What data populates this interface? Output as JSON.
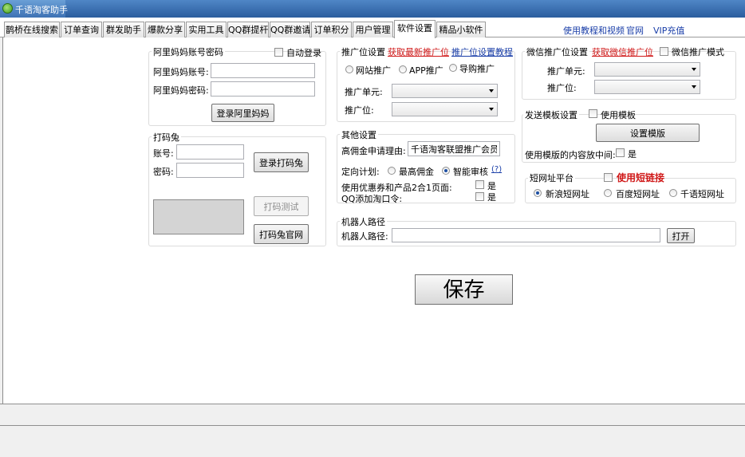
{
  "window": {
    "title": "千语淘客助手"
  },
  "tabs": [
    {
      "label": "鹊桥在线搜索"
    },
    {
      "label": "订单查询"
    },
    {
      "label": "群发助手"
    },
    {
      "label": "爆款分享"
    },
    {
      "label": "实用工具"
    },
    {
      "label": "QQ群提杆"
    },
    {
      "label": "QQ群邀请"
    },
    {
      "label": "订单积分"
    },
    {
      "label": "用户管理"
    },
    {
      "label": "软件设置"
    },
    {
      "label": "精品小软件"
    }
  ],
  "top_links": {
    "tutorial": "使用教程和视频",
    "official": "官网",
    "vip": "VIP充值"
  },
  "alimama": {
    "title": "阿里妈妈账号密码",
    "auto_login": "自动登录",
    "account_label": "阿里妈妈账号:",
    "account_value": "",
    "password_label": "阿里妈妈密码:",
    "password_value": "",
    "login_button": "登录阿里妈妈"
  },
  "captcha": {
    "title": "打码兔",
    "account_label": "账号:",
    "account_value": "",
    "password_label": "密码:",
    "password_value": "",
    "login_button": "登录打码兔",
    "test_button": "打码测试",
    "site_button": "打码兔官网"
  },
  "promo": {
    "title": "推广位设置",
    "get_latest_link": "获取最新推广位",
    "tutorial_link": "推广位设置教程",
    "radio_site": "网站推广",
    "radio_app": "APP推广",
    "radio_guide": "导购推广",
    "unit_label": "推广单元:",
    "position_label": "推广位:"
  },
  "other": {
    "title": "其他设置",
    "reason_label": "高佣金申请理由:",
    "reason_value": "千语淘客联盟推广会员,",
    "plan_label": "定向计划:",
    "plan_highest": "最高佣金",
    "plan_smart": "智能审核",
    "plan_help": "(?)",
    "coupon_label": "使用优惠券和产品2合1页面:",
    "coupon_yes": "是",
    "qq_label": "QQ添加淘口令:",
    "qq_yes": "是"
  },
  "robot": {
    "title": "机器人路径",
    "path_label": "机器人路径:",
    "path_value": "",
    "open_button": "打开"
  },
  "wechat": {
    "title": "微信推广位设置",
    "get_link": "获取微信推广位",
    "mode_label": "微信推广模式",
    "unit_label": "推广单元:",
    "position_label": "推广位:"
  },
  "template": {
    "title": "发送模板设置",
    "use_label": "使用模板",
    "set_button": "设置模版",
    "middle_label": "使用模版的内容放中间:",
    "middle_yes": "是"
  },
  "shorturl": {
    "title": "短网址平台",
    "use_label": "使用短链接",
    "sina": "新浪短网址",
    "baidu": "百度短网址",
    "qianyu": "千语短网址"
  },
  "save_button": "保存",
  "colors": {
    "link": "#1a3ea8",
    "red": "#d01818",
    "titlebar": "#2b5d9e"
  }
}
